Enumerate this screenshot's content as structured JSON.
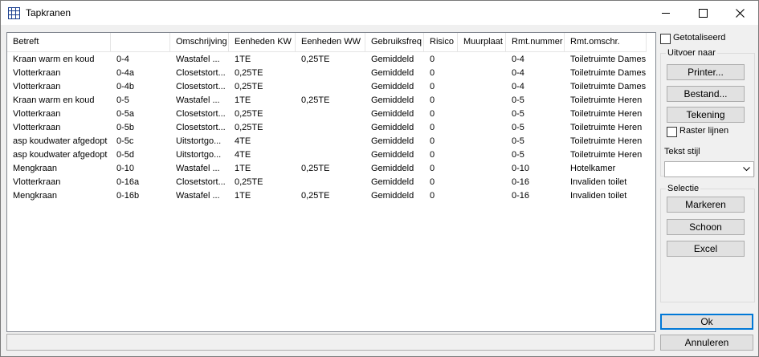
{
  "window": {
    "title": "Tapkranen",
    "app_icon": "grid-table-icon"
  },
  "table": {
    "columns": [
      "Betreft",
      "",
      "Omschrijving",
      "Eenheden KW",
      "Eenheden WW",
      "Gebruiksfreq",
      "Risico",
      "Muurplaat",
      "Rmt.nummer",
      "Rmt.omschr."
    ],
    "rows": [
      [
        "Kraan warm en koud",
        "0-4",
        "Wastafel ...",
        "1TE",
        "0,25TE",
        "Gemiddeld",
        "0",
        "",
        "0-4",
        "Toiletruimte Dames"
      ],
      [
        "Vlotterkraan",
        "0-4a",
        "Closetstort...",
        "0,25TE",
        "",
        "Gemiddeld",
        "0",
        "",
        "0-4",
        "Toiletruimte Dames"
      ],
      [
        "Vlotterkraan",
        "0-4b",
        "Closetstort...",
        "0,25TE",
        "",
        "Gemiddeld",
        "0",
        "",
        "0-4",
        "Toiletruimte Dames"
      ],
      [
        "Kraan warm en koud",
        "0-5",
        "Wastafel ...",
        "1TE",
        "0,25TE",
        "Gemiddeld",
        "0",
        "",
        "0-5",
        "Toiletruimte Heren"
      ],
      [
        "Vlotterkraan",
        "0-5a",
        "Closetstort...",
        "0,25TE",
        "",
        "Gemiddeld",
        "0",
        "",
        "0-5",
        "Toiletruimte Heren"
      ],
      [
        "Vlotterkraan",
        "0-5b",
        "Closetstort...",
        "0,25TE",
        "",
        "Gemiddeld",
        "0",
        "",
        "0-5",
        "Toiletruimte Heren"
      ],
      [
        "asp koudwater afgedopt",
        "0-5c",
        "Uitstortgo...",
        "4TE",
        "",
        "Gemiddeld",
        "0",
        "",
        "0-5",
        "Toiletruimte Heren"
      ],
      [
        "asp koudwater afgedopt",
        "0-5d",
        "Uitstortgo...",
        "4TE",
        "",
        "Gemiddeld",
        "0",
        "",
        "0-5",
        "Toiletruimte Heren"
      ],
      [
        "Mengkraan",
        "0-10",
        "Wastafel ...",
        "1TE",
        "0,25TE",
        "Gemiddeld",
        "0",
        "",
        "0-10",
        "Hotelkamer"
      ],
      [
        "Vlotterkraan",
        "0-16a",
        "Closetstort...",
        "0,25TE",
        "",
        "Gemiddeld",
        "0",
        "",
        "0-16",
        "Invaliden toilet"
      ],
      [
        "Mengkraan",
        "0-16b",
        "Wastafel ...",
        "1TE",
        "0,25TE",
        "Gemiddeld",
        "0",
        "",
        "0-16",
        "Invaliden toilet"
      ]
    ]
  },
  "sidebar": {
    "getotaliseerd": "Getotaliseerd",
    "uitvoer_naar": "Uitvoer naar",
    "printer": "Printer...",
    "bestand": "Bestand...",
    "tekening": "Tekening",
    "raster_lijnen": "Raster lijnen",
    "tekst_stijl": "Tekst stijl",
    "selectie": "Selectie",
    "markeren": "Markeren",
    "schoon": "Schoon",
    "excel": "Excel",
    "ok": "Ok",
    "annuleren": "Annuleren"
  }
}
